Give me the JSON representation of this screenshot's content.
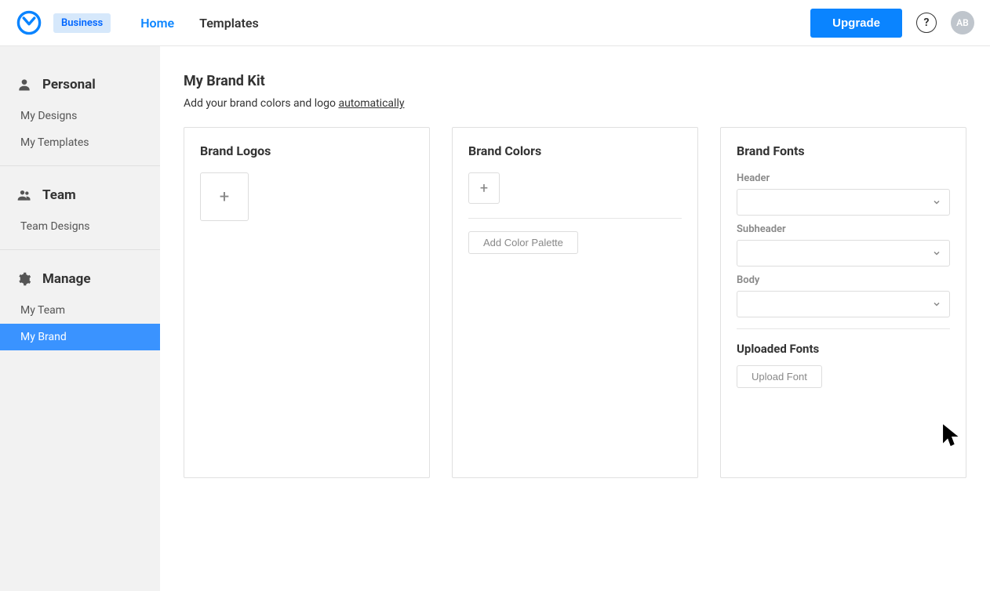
{
  "topbar": {
    "badge": "Business",
    "nav": [
      {
        "label": "Home",
        "active": true
      },
      {
        "label": "Templates",
        "active": false
      }
    ],
    "upgrade": "Upgrade",
    "help": "?",
    "avatar": "AB"
  },
  "sidebar": {
    "sections": [
      {
        "title": "Personal",
        "icon": "person",
        "items": [
          {
            "label": "My Designs",
            "active": false
          },
          {
            "label": "My Templates",
            "active": false
          }
        ]
      },
      {
        "title": "Team",
        "icon": "people",
        "items": [
          {
            "label": "Team Designs",
            "active": false
          }
        ]
      },
      {
        "title": "Manage",
        "icon": "gear",
        "items": [
          {
            "label": "My Team",
            "active": false
          },
          {
            "label": "My Brand",
            "active": true
          }
        ]
      }
    ]
  },
  "main": {
    "title": "My Brand Kit",
    "subtitle_prefix": "Add your brand colors and logo ",
    "subtitle_link": "automatically",
    "cards": {
      "logos": {
        "title": "Brand Logos"
      },
      "colors": {
        "title": "Brand Colors",
        "add_palette": "Add Color Palette"
      },
      "fonts": {
        "title": "Brand Fonts",
        "header_label": "Header",
        "subheader_label": "Subheader",
        "body_label": "Body",
        "uploaded_title": "Uploaded Fonts",
        "upload_btn": "Upload Font"
      }
    }
  }
}
